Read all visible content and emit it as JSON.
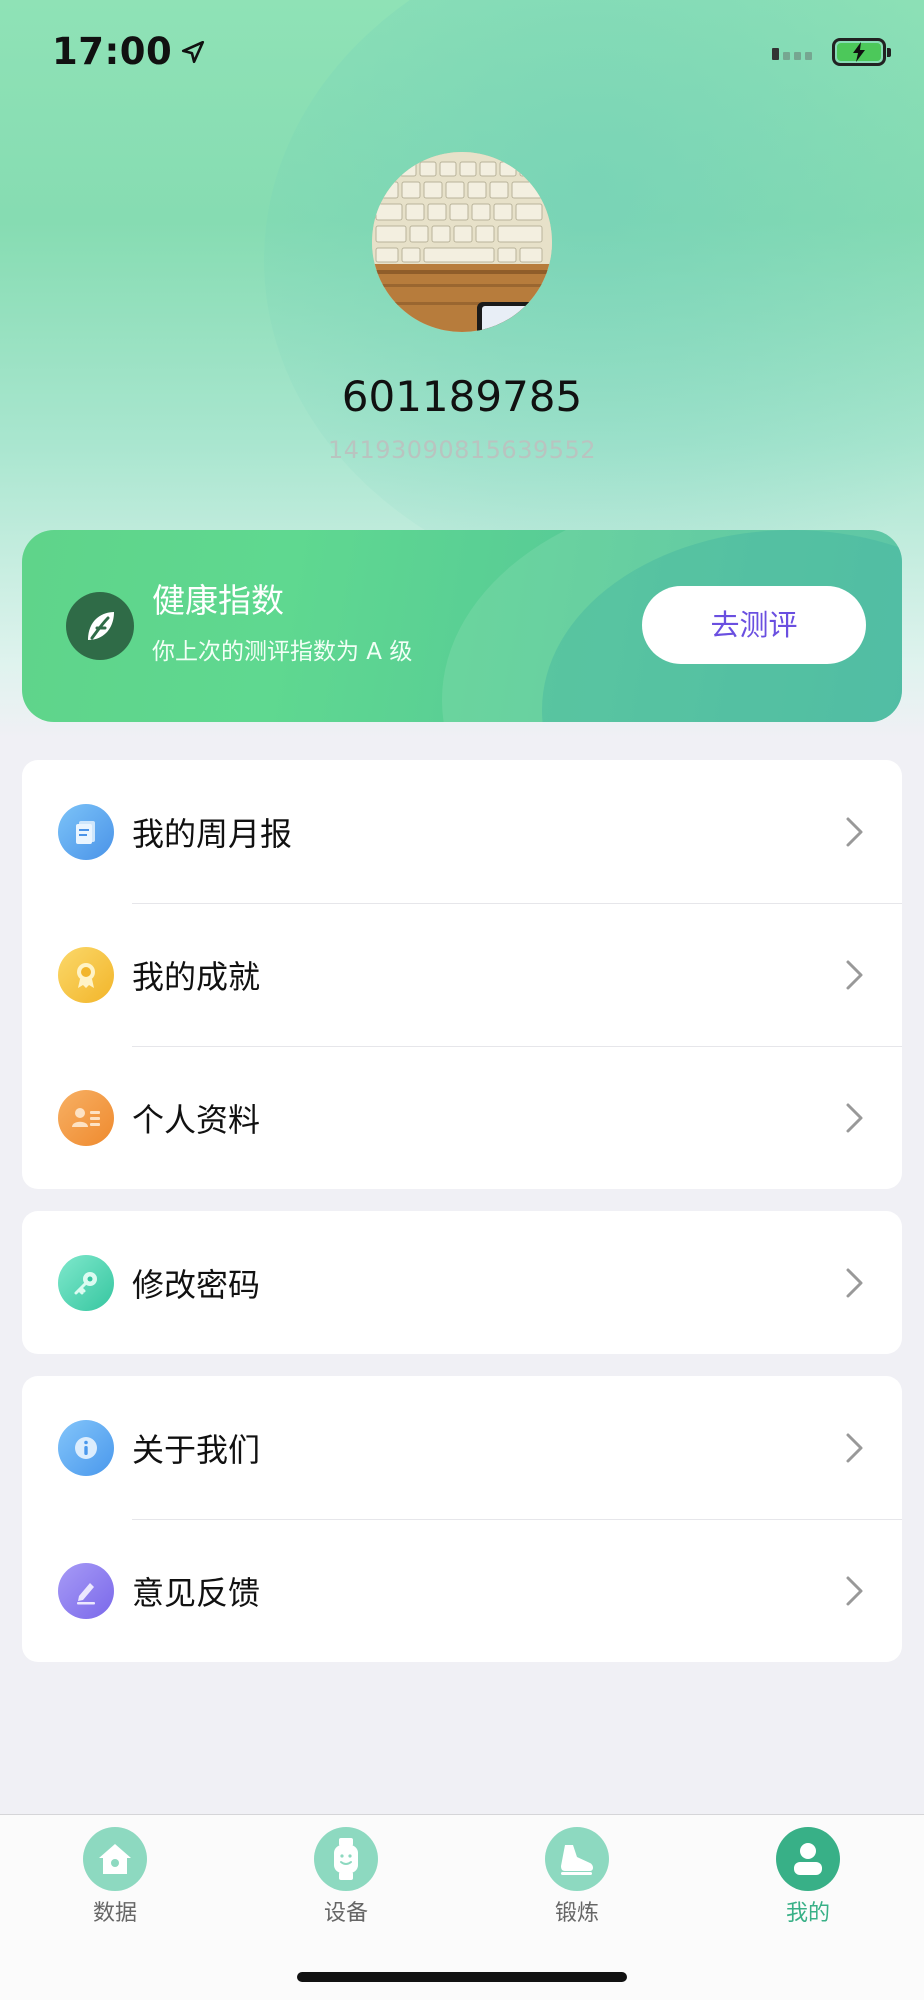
{
  "status_bar": {
    "time": "17:00",
    "location_icon": "location-arrow-icon",
    "signal_icon": "signal-icon",
    "battery_icon": "battery-charging-icon"
  },
  "profile": {
    "avatar": "keyboard photo avatar",
    "username": "601189785",
    "user_id": "14193090815639552"
  },
  "health_card": {
    "icon": "leaf-icon",
    "title": "健康指数",
    "subtitle": "你上次的测评指数为 A 级",
    "button_label": "去测评"
  },
  "menu_groups": [
    {
      "items": [
        {
          "label": "我的周月报",
          "icon": "report-icon",
          "color": "#5aa6f0"
        },
        {
          "label": "我的成就",
          "icon": "medal-icon",
          "color": "#f6c33d"
        },
        {
          "label": "个人资料",
          "icon": "profile-card-icon",
          "color": "#f29a3e"
        }
      ]
    },
    {
      "items": [
        {
          "label": "修改密码",
          "icon": "key-icon",
          "color": "#4fd6b6"
        }
      ]
    },
    {
      "items": [
        {
          "label": "关于我们",
          "icon": "info-icon",
          "color": "#5aa6f0"
        },
        {
          "label": "意见反馈",
          "icon": "feedback-pen-icon",
          "color": "#8b7cf0"
        }
      ]
    }
  ],
  "tabbar": {
    "tabs": [
      {
        "label": "数据",
        "icon": "home-icon",
        "active": false
      },
      {
        "label": "设备",
        "icon": "watch-icon",
        "active": false
      },
      {
        "label": "锻炼",
        "icon": "shoe-icon",
        "active": false
      },
      {
        "label": "我的",
        "icon": "user-icon",
        "active": true
      }
    ]
  },
  "colors": {
    "accent": "#38b087",
    "button_text": "#6a4fe0",
    "health_card": "#5fd48a"
  }
}
